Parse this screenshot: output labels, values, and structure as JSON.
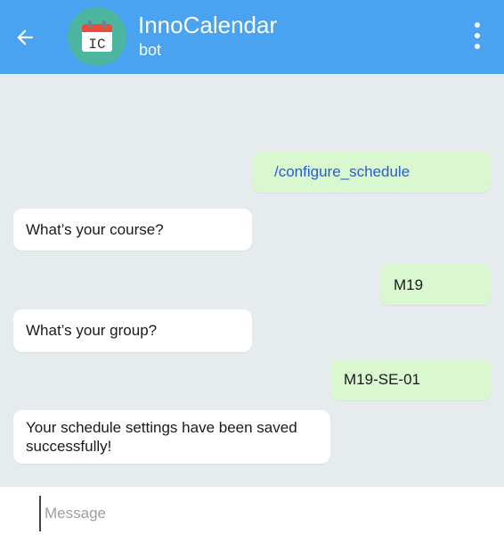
{
  "header": {
    "title": "InnoCalendar",
    "subtitle": "bot",
    "avatar_text": "IC",
    "avatar_bg": "#4db6a0",
    "bar_color": "#4aa3f0"
  },
  "messages": [
    {
      "side": "out",
      "text": "/configure_schedule",
      "is_command": true
    },
    {
      "side": "in",
      "text": "What’s your course?"
    },
    {
      "side": "out",
      "text": "M19"
    },
    {
      "side": "in",
      "text": "What’s your group?"
    },
    {
      "side": "out",
      "text": "M19-SE-01"
    },
    {
      "side": "in",
      "text": "Your schedule settings have been saved successfully!"
    }
  ],
  "composer": {
    "placeholder": "Message"
  },
  "icons": {
    "back": "arrow-left-icon",
    "menu": "more-vertical-icon",
    "avatar": "calendar-icon"
  },
  "colors": {
    "outgoing_bubble": "#daf8cf",
    "incoming_bubble": "#ffffff",
    "chat_background": "#e6ebee",
    "command_link": "#2a5bd7"
  }
}
